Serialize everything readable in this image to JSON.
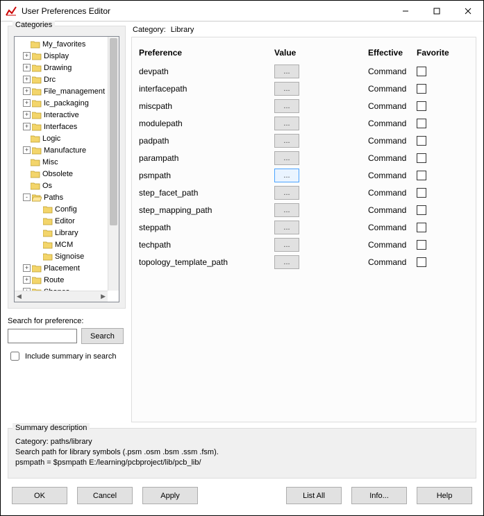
{
  "window": {
    "title": "User Preferences Editor"
  },
  "categories_label": "Categories",
  "category_bar": {
    "key": "Category:",
    "value": "Library"
  },
  "tree": {
    "items": [
      {
        "label": "My_favorites",
        "level": 1,
        "tw": ""
      },
      {
        "label": "Display",
        "level": 1,
        "tw": "+"
      },
      {
        "label": "Drawing",
        "level": 1,
        "tw": "+"
      },
      {
        "label": "Drc",
        "level": 1,
        "tw": "+"
      },
      {
        "label": "File_management",
        "level": 1,
        "tw": "+"
      },
      {
        "label": "Ic_packaging",
        "level": 1,
        "tw": "+"
      },
      {
        "label": "Interactive",
        "level": 1,
        "tw": "+"
      },
      {
        "label": "Interfaces",
        "level": 1,
        "tw": "+"
      },
      {
        "label": "Logic",
        "level": 1,
        "tw": ""
      },
      {
        "label": "Manufacture",
        "level": 1,
        "tw": "+"
      },
      {
        "label": "Misc",
        "level": 1,
        "tw": ""
      },
      {
        "label": "Obsolete",
        "level": 1,
        "tw": ""
      },
      {
        "label": "Os",
        "level": 1,
        "tw": ""
      },
      {
        "label": "Paths",
        "level": 1,
        "tw": "-"
      },
      {
        "label": "Config",
        "level": 2,
        "tw": ""
      },
      {
        "label": "Editor",
        "level": 2,
        "tw": ""
      },
      {
        "label": "Library",
        "level": 2,
        "tw": ""
      },
      {
        "label": "MCM",
        "level": 2,
        "tw": ""
      },
      {
        "label": "Signoise",
        "level": 2,
        "tw": ""
      },
      {
        "label": "Placement",
        "level": 1,
        "tw": "+"
      },
      {
        "label": "Route",
        "level": 1,
        "tw": "+"
      },
      {
        "label": "Shapes",
        "level": 1,
        "tw": "+"
      }
    ]
  },
  "search": {
    "label": "Search for preference:",
    "button": "Search",
    "include": "Include summary in search"
  },
  "headers": {
    "pref": "Preference",
    "val": "Value",
    "eff": "Effective",
    "fav": "Favorite"
  },
  "prefs": [
    {
      "name": "devpath",
      "val": "...",
      "eff": "Command",
      "sel": false
    },
    {
      "name": "interfacepath",
      "val": "...",
      "eff": "Command",
      "sel": false
    },
    {
      "name": "miscpath",
      "val": "...",
      "eff": "Command",
      "sel": false
    },
    {
      "name": "modulepath",
      "val": "...",
      "eff": "Command",
      "sel": false
    },
    {
      "name": "padpath",
      "val": "...",
      "eff": "Command",
      "sel": false
    },
    {
      "name": "parampath",
      "val": "...",
      "eff": "Command",
      "sel": false
    },
    {
      "name": "psmpath",
      "val": "...",
      "eff": "Command",
      "sel": true
    },
    {
      "name": "step_facet_path",
      "val": "...",
      "eff": "Command",
      "sel": false
    },
    {
      "name": "step_mapping_path",
      "val": "...",
      "eff": "Command",
      "sel": false
    },
    {
      "name": "steppath",
      "val": "...",
      "eff": "Command",
      "sel": false
    },
    {
      "name": "techpath",
      "val": "...",
      "eff": "Command",
      "sel": false
    },
    {
      "name": "topology_template_path",
      "val": "...",
      "eff": "Command",
      "sel": false
    }
  ],
  "summary": {
    "label": "Summary description",
    "line1": "Category: paths/library",
    "line2": "Search path for library symbols (.psm .osm .bsm .ssm .fsm).",
    "line3": "psmpath = $psmpath E:/learning/pcbproject/lib/pcb_lib/"
  },
  "buttons": {
    "ok": "OK",
    "cancel": "Cancel",
    "apply": "Apply",
    "listall": "List All",
    "info": "Info...",
    "help": "Help"
  }
}
